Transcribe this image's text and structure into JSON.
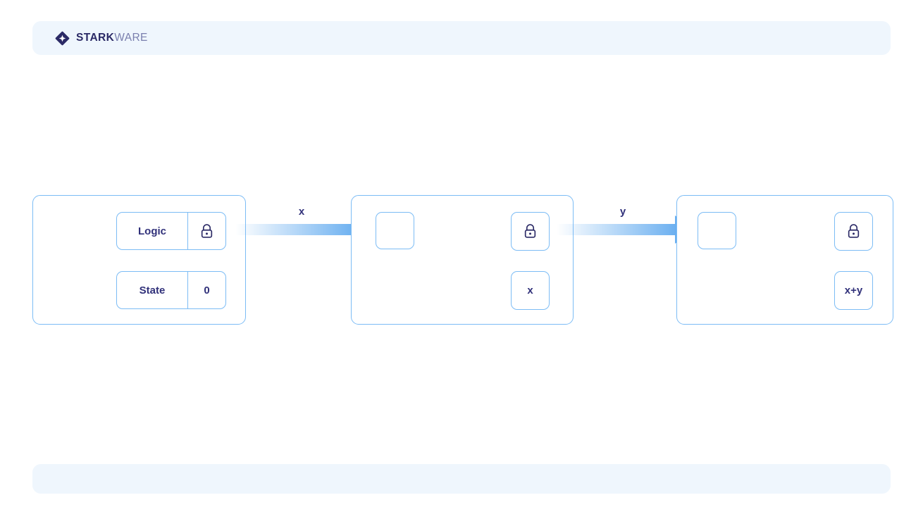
{
  "brand": {
    "name_bold": "STARK",
    "name_light": "WARE",
    "logo_icon": "starkware-diamond-logo",
    "navy": "#2b2a66",
    "light_text": "#7a7fae"
  },
  "theme": {
    "background": "#ffffff",
    "banner_fill": "#eff6fd",
    "card_border": "#7cbcf5",
    "text_navy": "#31317a",
    "arrow_blue": "#6aaff0"
  },
  "banners": {
    "top": "",
    "bottom": ""
  },
  "diagram": {
    "cards": [
      {
        "id": "card-1",
        "rows": [
          {
            "label": "Logic",
            "value": "",
            "value_icon": "lock-icon"
          },
          {
            "label": "State",
            "value": "0",
            "value_icon": ""
          }
        ]
      },
      {
        "id": "card-2",
        "input_box": "",
        "boxes": [
          {
            "label": "",
            "icon": "lock-icon"
          },
          {
            "label": "x",
            "icon": ""
          }
        ]
      },
      {
        "id": "card-3",
        "input_box": "",
        "boxes": [
          {
            "label": "",
            "icon": "lock-icon"
          },
          {
            "label": "x+y",
            "icon": ""
          }
        ]
      }
    ],
    "arrows": [
      {
        "id": "arrow-1",
        "label": "x",
        "icon": "arrow-right-icon"
      },
      {
        "id": "arrow-2",
        "label": "y",
        "icon": "arrow-right-icon"
      }
    ]
  }
}
